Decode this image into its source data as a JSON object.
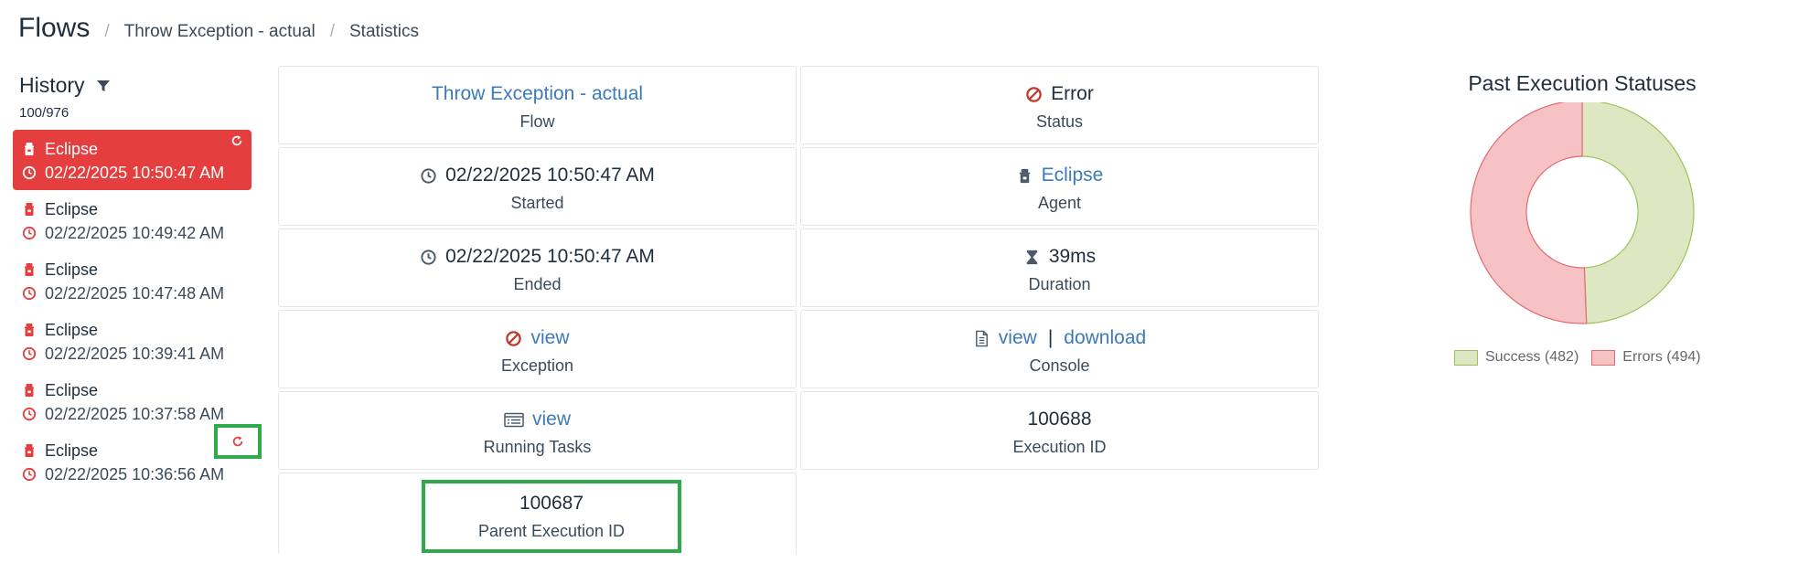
{
  "header": {
    "title": "Flows",
    "breadcrumb": [
      "Throw Exception - actual",
      "Statistics"
    ]
  },
  "history": {
    "title": "History",
    "count": "100/976",
    "items": [
      {
        "agent": "Eclipse",
        "date": "02/22/2025 10:50:47 AM",
        "active": true
      },
      {
        "agent": "Eclipse",
        "date": "02/22/2025 10:49:42 AM"
      },
      {
        "agent": "Eclipse",
        "date": "02/22/2025 10:47:48 AM"
      },
      {
        "agent": "Eclipse",
        "date": "02/22/2025 10:39:41 AM"
      },
      {
        "agent": "Eclipse",
        "date": "02/22/2025 10:37:58 AM"
      },
      {
        "agent": "Eclipse",
        "date": "02/22/2025 10:36:56 AM"
      }
    ]
  },
  "details": {
    "flow": {
      "value": "Throw Exception - actual",
      "label": "Flow"
    },
    "status": {
      "value": "Error",
      "label": "Status"
    },
    "started": {
      "value": "02/22/2025 10:50:47 AM",
      "label": "Started"
    },
    "agent": {
      "value": "Eclipse",
      "label": "Agent"
    },
    "ended": {
      "value": "02/22/2025 10:50:47 AM",
      "label": "Ended"
    },
    "duration": {
      "value": "39ms",
      "label": "Duration"
    },
    "exception": {
      "value": "view",
      "label": "Exception"
    },
    "console": {
      "view": "view",
      "separator": "|",
      "download": "download",
      "label": "Console"
    },
    "running_tasks": {
      "value": "view",
      "label": "Running Tasks"
    },
    "execution_id": {
      "value": "100688",
      "label": "Execution ID"
    },
    "parent_execution_id": {
      "value": "100687",
      "label": "Parent Execution ID"
    }
  },
  "colors": {
    "accent_red": "#e53e3e",
    "link": "#3d7ab8",
    "highlight_green": "#2eaa4a",
    "success_fill": "#dde8c3",
    "success_stroke": "#9ec15a",
    "error_fill": "#f6c2c4",
    "error_stroke": "#e06b70"
  },
  "icons": {
    "filter": "filter-icon",
    "agent": "agent-icon",
    "clock": "clock-icon",
    "refresh": "refresh-icon",
    "ban": "ban-icon",
    "hourglass": "hourglass-icon",
    "file": "file-icon",
    "list": "list-icon"
  },
  "chart_data": {
    "type": "pie",
    "title": "Past Execution Statuses",
    "donut": true,
    "categories": [
      "Success (482)",
      "Errors (494)"
    ],
    "values": [
      482,
      494
    ],
    "legend": "bottom"
  }
}
